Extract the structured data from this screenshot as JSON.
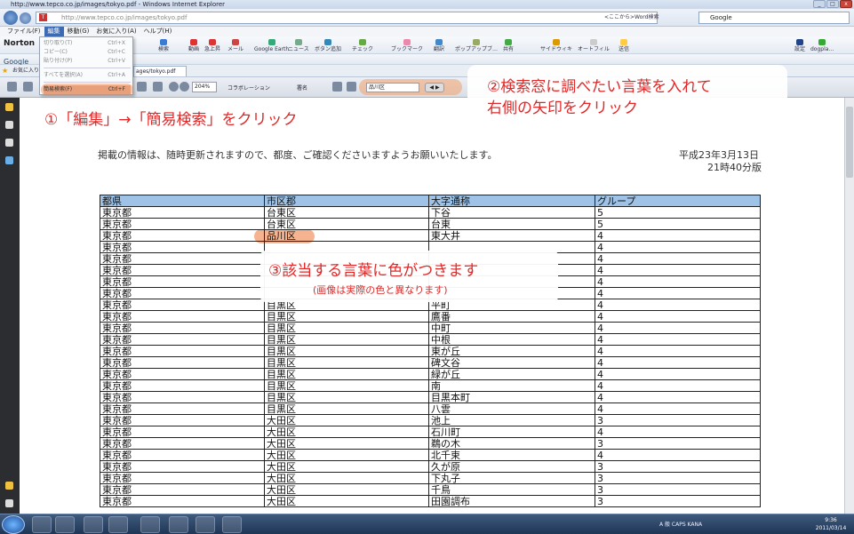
{
  "window": {
    "title": "http://www.tepco.co.jp/images/tokyo.pdf - Windows Internet Explorer",
    "url": "http://www.tepco.co.jp/images/tokyo.pdf",
    "search_engine": "Google",
    "search_hint": "<ここから>Word検索"
  },
  "menubar": [
    "ファイル(F)",
    "編集",
    "移動(G)",
    "お気に入り(A)",
    "ヘルプ(H)"
  ],
  "edit_menu": {
    "items": [
      {
        "label": "切り取り(T)",
        "shortcut": "Ctrl+X"
      },
      {
        "label": "コピー(C)",
        "shortcut": "Ctrl+C"
      },
      {
        "label": "貼り付け(P)",
        "shortcut": "Ctrl+V"
      },
      {
        "label": "すべてを選択(A)",
        "shortcut": "Ctrl+A"
      },
      {
        "label": "簡易検索(F)",
        "shortcut": "Ctrl+F"
      }
    ]
  },
  "toolbar": {
    "norton": "Norton",
    "google": "Google",
    "items": [
      "検索",
      "動画",
      "急上昇",
      "メール",
      "Google Earth",
      "ニュース",
      "ボタン追加",
      "チェック",
      "ブックマーク",
      "翻訳",
      "ポップアップブ…",
      "共有",
      "サイドウィキ",
      "オートフィル",
      "送信",
      "設定",
      "dogpla…"
    ],
    "fav_label": "お気に入り",
    "tab_label": "ages/tokyo.pdf"
  },
  "pdf_toolbar": {
    "zoom": "204%",
    "collab": "コラボレーション",
    "sign": "署名",
    "find_value": "品川区"
  },
  "annotations": {
    "a1": "①「編集」→「簡易検索」をクリック",
    "a2_line1": "②検索窓に調べたい言葉を入れて",
    "a2_line2": "右側の矢印をクリック",
    "a3_line1": "③該当する言葉に色がつきます",
    "a3_line2": "(画像は実際の色と異なります)"
  },
  "document": {
    "notice": "掲載の情報は、随時更新されますので、都度、ご確認くださいますようお願いいたします。",
    "date_line1": "平成23年3月13日",
    "date_line2": "21時40分版",
    "headers": [
      "都県",
      "市区郡",
      "大字通称",
      "グループ"
    ],
    "rows": [
      [
        "東京都",
        "台東区",
        "下谷",
        "5"
      ],
      [
        "東京都",
        "台東区",
        "台東",
        "5"
      ],
      [
        "東京都",
        "品川区",
        "東大井",
        "4"
      ],
      [
        "東京都",
        "",
        "",
        "4"
      ],
      [
        "東京都",
        "",
        "",
        "4"
      ],
      [
        "東京都",
        "",
        "",
        "4"
      ],
      [
        "東京都",
        "",
        "",
        "4"
      ],
      [
        "東京都",
        "",
        "",
        "4"
      ],
      [
        "東京都",
        "目黒区",
        "平町",
        "4"
      ],
      [
        "東京都",
        "目黒区",
        "鷹番",
        "4"
      ],
      [
        "東京都",
        "目黒区",
        "中町",
        "4"
      ],
      [
        "東京都",
        "目黒区",
        "中根",
        "4"
      ],
      [
        "東京都",
        "目黒区",
        "東が丘",
        "4"
      ],
      [
        "東京都",
        "目黒区",
        "碑文谷",
        "4"
      ],
      [
        "東京都",
        "目黒区",
        "緑が丘",
        "4"
      ],
      [
        "東京都",
        "目黒区",
        "南",
        "4"
      ],
      [
        "東京都",
        "目黒区",
        "目黒本町",
        "4"
      ],
      [
        "東京都",
        "目黒区",
        "八雲",
        "4"
      ],
      [
        "東京都",
        "大田区",
        "池上",
        "3"
      ],
      [
        "東京都",
        "大田区",
        "石川町",
        "4"
      ],
      [
        "東京都",
        "大田区",
        "鵜の木",
        "3"
      ],
      [
        "東京都",
        "大田区",
        "北千束",
        "4"
      ],
      [
        "東京都",
        "大田区",
        "久が原",
        "3"
      ],
      [
        "東京都",
        "大田区",
        "下丸子",
        "3"
      ],
      [
        "東京都",
        "大田区",
        "千鳥",
        "3"
      ],
      [
        "東京都",
        "大田区",
        "田園調布",
        "3"
      ]
    ]
  },
  "taskbar": {
    "clock_time": "9:36",
    "clock_date": "2011/03/14",
    "tray_text": "A 般 CAPS KANA"
  }
}
